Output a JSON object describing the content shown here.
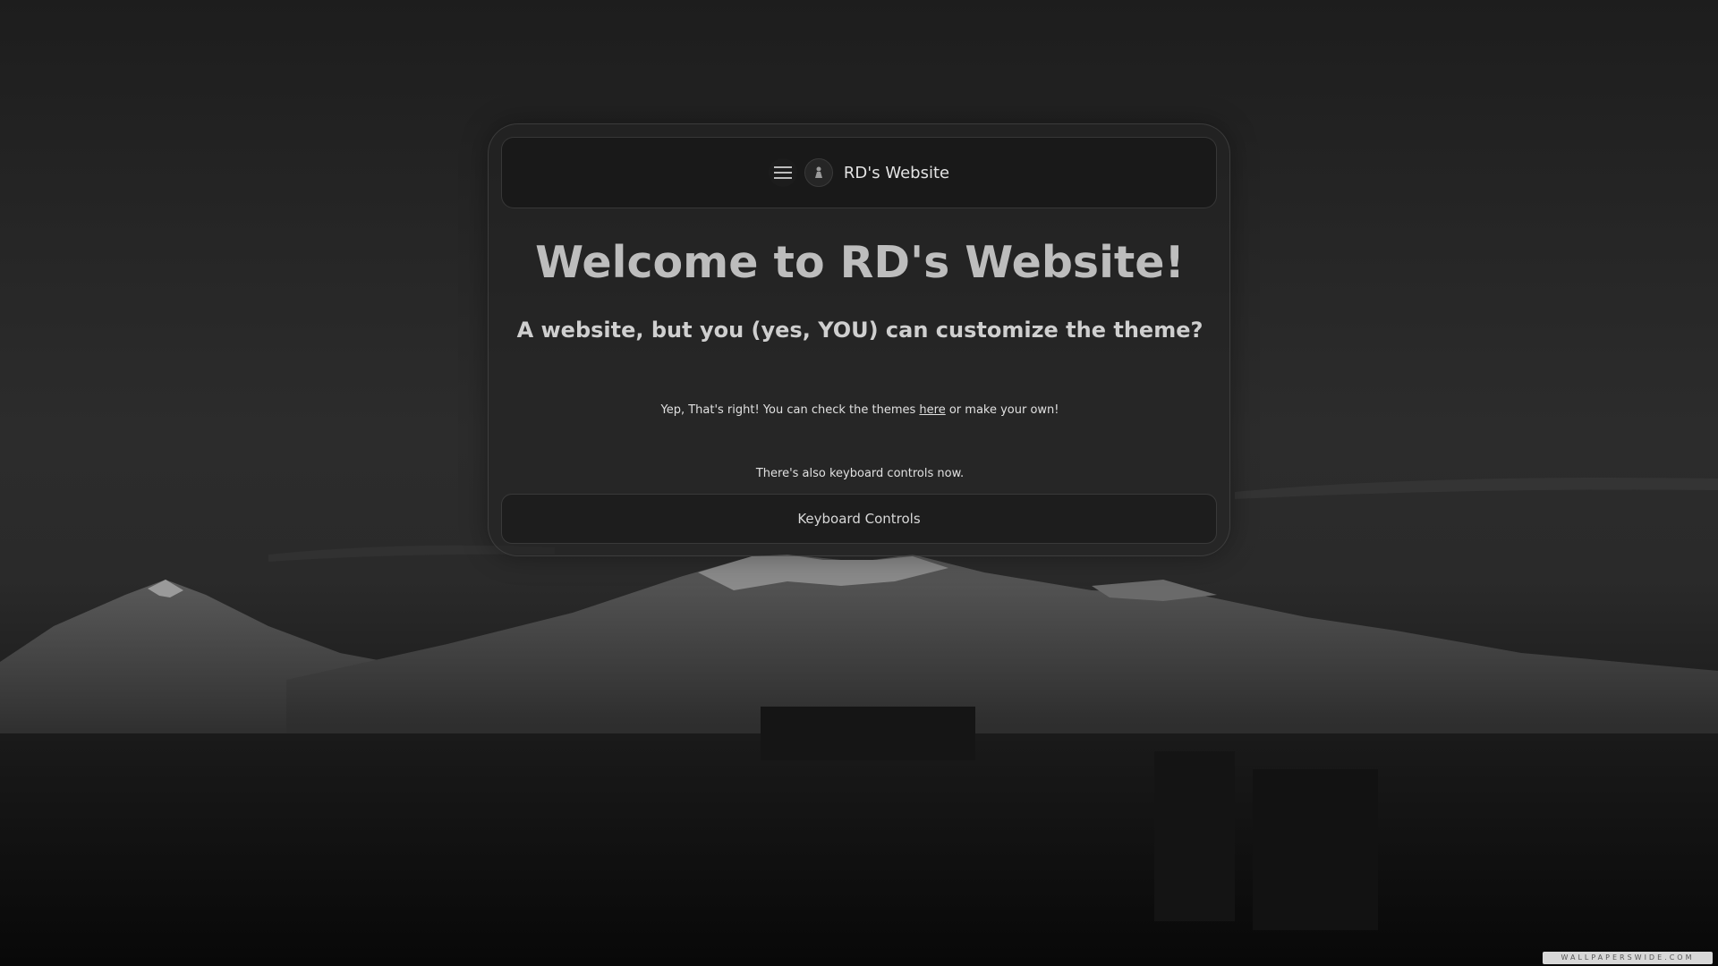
{
  "navbar": {
    "menu_icon": "hamburger-menu-icon",
    "logo_icon": "site-logo-icon",
    "site_title": "RD's Website"
  },
  "hero": {
    "title": "Welcome to RD's Website!",
    "subtitle": "A website, but you (yes, YOU) can customize the theme?"
  },
  "content": {
    "line1_before": "Yep, That's right! You can check the themes ",
    "line1_link": "here",
    "line1_after": " or make your own!",
    "line2": "There's also keyboard controls now."
  },
  "actions": {
    "keyboard_controls": "Keyboard Controls"
  },
  "background": {
    "watermark": "WALLPAPERSWIDE.COM"
  },
  "colors": {
    "page_bg": "#1d1d1d",
    "card_bg": "#222222",
    "text": "#cfcfcf"
  }
}
